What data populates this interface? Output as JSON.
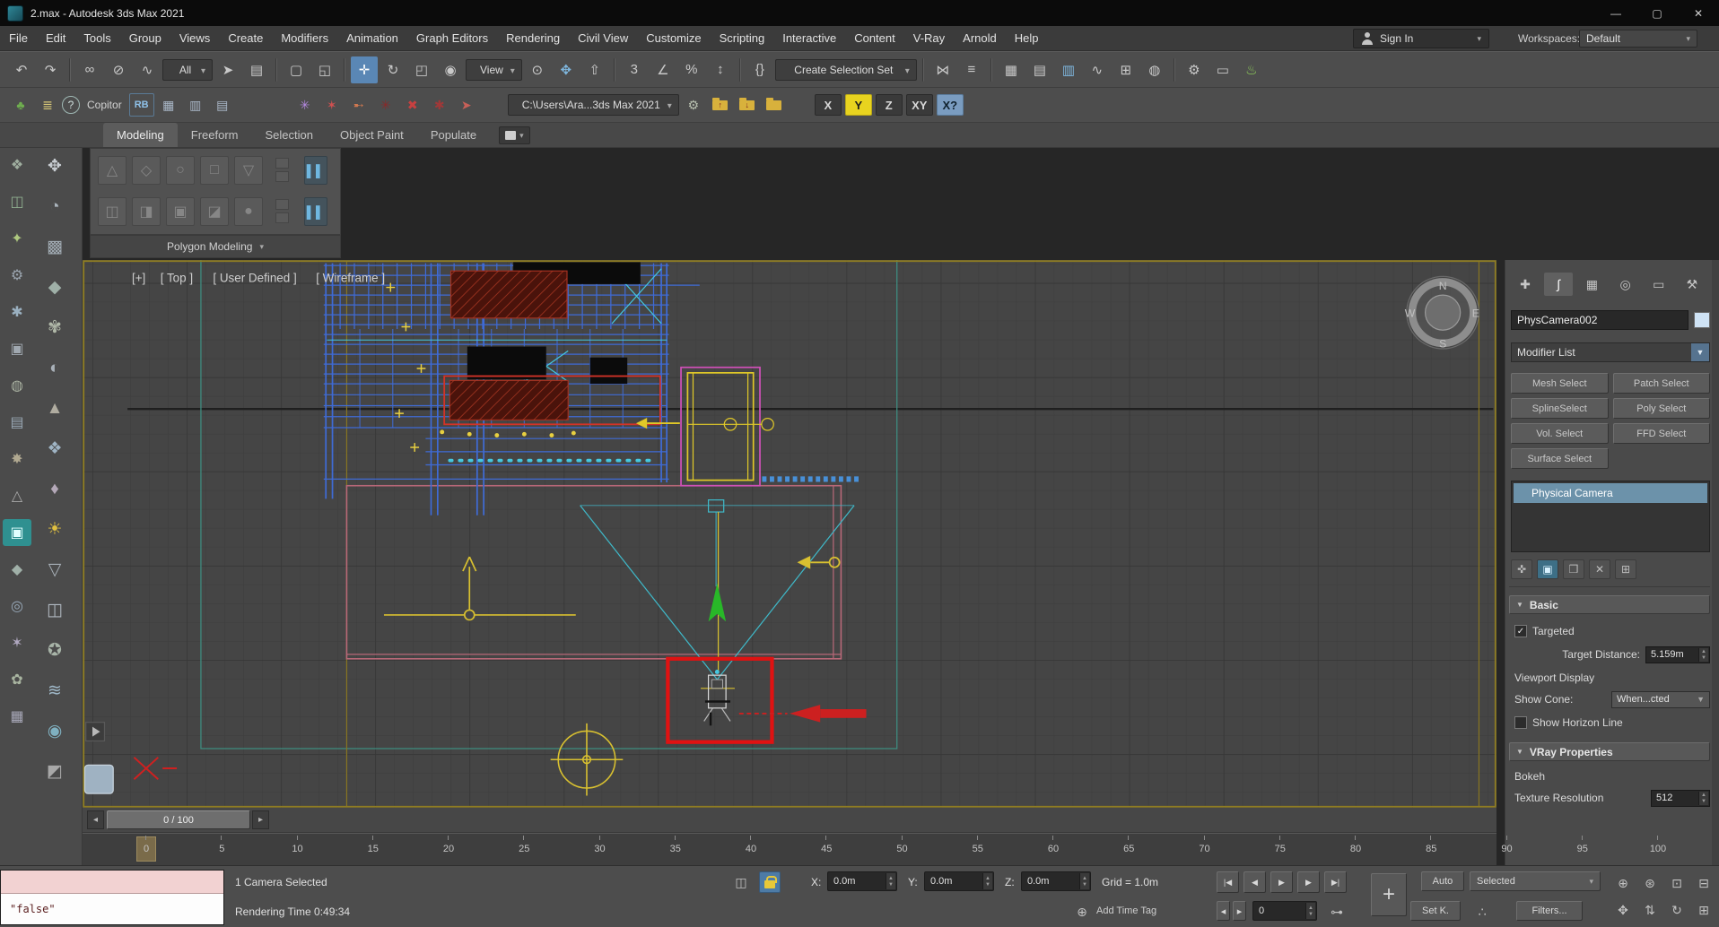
{
  "window": {
    "title": "2.max - Autodesk 3ds Max 2021",
    "controls": {
      "minimize": "—",
      "maximize": "▢",
      "close": "✕"
    }
  },
  "menubar": {
    "items": [
      "File",
      "Edit",
      "Tools",
      "Group",
      "Views",
      "Create",
      "Modifiers",
      "Animation",
      "Graph Editors",
      "Rendering",
      "Civil View",
      "Customize",
      "Scripting",
      "Interactive",
      "Content",
      "V-Ray",
      "Arnold",
      "Help"
    ],
    "sign_in": "Sign In",
    "sign_in_caret": "▾",
    "workspaces_label": "Workspaces:",
    "workspaces_value": "Default",
    "workspaces_caret": "▾"
  },
  "toolbar1": {
    "items": [
      {
        "name": "undo-icon",
        "kind": "icon",
        "glyph": "↶"
      },
      {
        "name": "redo-icon",
        "kind": "icon",
        "glyph": "↷"
      },
      {
        "name": "toolbar-separator",
        "kind": "sep"
      },
      {
        "name": "select-and-link-icon",
        "kind": "icon",
        "glyph": "∞"
      },
      {
        "name": "unlink-selection-icon",
        "kind": "icon",
        "glyph": "⊘"
      },
      {
        "name": "bind-to-space-warp-icon",
        "kind": "icon",
        "glyph": "∿"
      },
      {
        "name": "selection-filter-dropdown",
        "kind": "dd",
        "label": "All"
      },
      {
        "name": "select-object-icon",
        "kind": "icon",
        "glyph": "➤"
      },
      {
        "name": "select-by-name-icon",
        "kind": "icon",
        "glyph": "▤"
      },
      {
        "name": "toolbar-separator",
        "kind": "sep"
      },
      {
        "name": "rectangular-selection-icon",
        "kind": "icon",
        "glyph": "▢"
      },
      {
        "name": "window-crossing-icon",
        "kind": "icon",
        "glyph": "◱"
      },
      {
        "name": "toolbar-separator",
        "kind": "sep"
      },
      {
        "name": "select-and-move-icon",
        "kind": "icon",
        "glyph": "✛",
        "variant": "active"
      },
      {
        "name": "select-and-rotate-icon",
        "kind": "icon",
        "glyph": "↻"
      },
      {
        "name": "select-and-scale-icon",
        "kind": "icon",
        "glyph": "◰"
      },
      {
        "name": "select-and-place-icon",
        "kind": "icon",
        "glyph": "◉"
      },
      {
        "name": "reference-coordinate-dropdown",
        "kind": "dd",
        "label": "View"
      },
      {
        "name": "use-pivot-center-icon",
        "kind": "icon",
        "glyph": "⊙"
      },
      {
        "name": "select-and-manipulate-icon",
        "kind": "icon",
        "glyph": "✥",
        "variant": "blue"
      },
      {
        "name": "keyboard-shortcut-override-icon",
        "kind": "icon",
        "glyph": "⇧"
      },
      {
        "name": "toolbar-separator",
        "kind": "sep"
      },
      {
        "name": "snaps-toggle-icon",
        "kind": "icon",
        "glyph": "3"
      },
      {
        "name": "angle-snap-icon",
        "kind": "icon",
        "glyph": "∠"
      },
      {
        "name": "percent-snap-icon",
        "kind": "icon",
        "glyph": "%"
      },
      {
        "name": "spinner-snap-icon",
        "kind": "icon",
        "glyph": "↕"
      },
      {
        "name": "toolbar-separator",
        "kind": "sep"
      },
      {
        "name": "edit-named-selection-sets-icon",
        "kind": "icon",
        "glyph": "{}"
      },
      {
        "name": "named-selection-set-dropdown",
        "kind": "dd",
        "label": "Create Selection Set",
        "style": "min-width:158px"
      },
      {
        "name": "toolbar-separator",
        "kind": "sep"
      },
      {
        "name": "mirror-icon",
        "kind": "icon",
        "glyph": "⋈"
      },
      {
        "name": "align-icon",
        "kind": "icon",
        "glyph": "≡"
      },
      {
        "name": "toolbar-separator",
        "kind": "sep"
      },
      {
        "name": "scene-explorer-icon",
        "kind": "icon",
        "glyph": "▦"
      },
      {
        "name": "layer-explorer-icon",
        "kind": "icon",
        "glyph": "▤"
      },
      {
        "name": "ribbon-toggle-icon",
        "kind": "icon",
        "glyph": "▥",
        "variant": "blue"
      },
      {
        "name": "curve-editor-icon",
        "kind": "icon",
        "glyph": "∿"
      },
      {
        "name": "schematic-view-icon",
        "kind": "icon",
        "glyph": "⊞"
      },
      {
        "name": "material-editor-icon",
        "kind": "icon",
        "glyph": "◍"
      },
      {
        "name": "toolbar-separator",
        "kind": "sep"
      },
      {
        "name": "render-setup-icon",
        "kind": "icon",
        "glyph": "⚙"
      },
      {
        "name": "rendered-frame-window-icon",
        "kind": "icon",
        "glyph": "▭"
      },
      {
        "name": "render-production-icon",
        "kind": "icon",
        "glyph": "♨",
        "variant": "green"
      }
    ]
  },
  "toolbar2": {
    "items": [
      {
        "name": "plant-icon",
        "kind": "icon",
        "glyph": "♣",
        "style": "color:#6fae4f"
      },
      {
        "name": "menu-list-icon",
        "kind": "icon",
        "glyph": "≣",
        "style": "color:#d8c878"
      },
      {
        "name": "help-icon",
        "kind": "icon",
        "glyph": "?",
        "style": "color:#cfe0de;border:1px solid #9fb8b4;border-radius:50%;min-width:20px;height:20px;font-size:12px"
      },
      {
        "name": "copitor-label",
        "kind": "label",
        "label": "Copitor"
      },
      {
        "name": "rb-button",
        "kind": "icon",
        "glyph": "RB",
        "style": "color:#8fc1e8;font-size:11px;font-weight:bold;border:1px solid #5a7a96;border-radius:2px"
      },
      {
        "name": "array-table-icon",
        "kind": "icon",
        "glyph": "▦",
        "style": "color:#aab8c8"
      },
      {
        "name": "grid-table-icon",
        "kind": "icon",
        "glyph": "▥",
        "style": "color:#aab8c8"
      },
      {
        "name": "columns-table-icon",
        "kind": "icon",
        "glyph": "▤",
        "style": "color:#aab8c8"
      },
      {
        "name": "toolbar-gap",
        "kind": "gap",
        "style": "min-width:60px"
      },
      {
        "name": "script-star-purple-icon",
        "kind": "icon",
        "glyph": "✳",
        "style": "color:#b488e0"
      },
      {
        "name": "script-star-red-icon",
        "kind": "icon",
        "glyph": "✶",
        "style": "color:#d05050"
      },
      {
        "name": "script-arrow-icon",
        "kind": "icon",
        "glyph": "➸",
        "style": "color:#d07850"
      },
      {
        "name": "script-star-darkred-icon",
        "kind": "icon",
        "glyph": "✳",
        "style": "color:#8a2828"
      },
      {
        "name": "script-cross-icon",
        "kind": "icon",
        "glyph": "✖",
        "style": "color:#c84040"
      },
      {
        "name": "script-star-maroon-icon",
        "kind": "icon",
        "glyph": "✱",
        "style": "color:#a03838"
      },
      {
        "name": "script-pointer-icon",
        "kind": "icon",
        "glyph": "➤",
        "style": "color:#c86058"
      },
      {
        "name": "toolbar-gap",
        "kind": "gap",
        "style": "min-width:28px"
      },
      {
        "name": "project-path-dropdown",
        "kind": "dd",
        "label": "C:\\Users\\Ara...3ds Max 2021",
        "style": "min-width:170px"
      },
      {
        "name": "settings-gear-icon",
        "kind": "icon",
        "glyph": "⚙",
        "style": "color:#b8c0b0"
      },
      {
        "name": "folder-up-icon",
        "kind": "folder",
        "glyph": "↑"
      },
      {
        "name": "folder-down-icon",
        "kind": "folder",
        "glyph": "↓"
      },
      {
        "name": "folder-open-icon",
        "kind": "folder",
        "glyph": ""
      },
      {
        "name": "toolbar-gap",
        "kind": "gap",
        "style": "min-width:26px"
      },
      {
        "name": "axis-x-button",
        "kind": "axis",
        "label": "X"
      },
      {
        "name": "axis-y-button",
        "kind": "axis",
        "label": "Y",
        "variant": "yellow"
      },
      {
        "name": "axis-z-button",
        "kind": "axis",
        "label": "Z"
      },
      {
        "name": "axis-xy-button",
        "kind": "axis",
        "label": "XY"
      },
      {
        "name": "axis-x2-button",
        "kind": "axis",
        "label": "X?",
        "variant": "bluebg"
      }
    ]
  },
  "ribbon": {
    "tabs": [
      {
        "label": "Modeling",
        "variant": "active"
      },
      {
        "label": "Freeform"
      },
      {
        "label": "Selection"
      },
      {
        "label": "Object Paint"
      },
      {
        "label": "Populate"
      }
    ],
    "tab_menu_caret": "▾",
    "row1": [
      {
        "name": "polygon-tool-icon",
        "glyph": "△"
      },
      {
        "name": "loop-tool-icon",
        "glyph": "◇"
      },
      {
        "name": "ring-tool-icon",
        "glyph": "○"
      },
      {
        "name": "quad-tool-icon",
        "glyph": "□"
      },
      {
        "name": "cap-tool-icon",
        "glyph": "▽"
      }
    ],
    "row2": [
      {
        "name": "extrude-tool-icon",
        "glyph": "◫"
      },
      {
        "name": "bevel-tool-icon",
        "glyph": "◨"
      },
      {
        "name": "inset-tool-icon",
        "glyph": "▣"
      },
      {
        "name": "bridge-tool-icon",
        "glyph": "◪"
      },
      {
        "name": "weld-tool-icon",
        "glyph": "●"
      }
    ],
    "panel_toggle_glyph": "▌▌",
    "section_label": "Polygon Modeling",
    "section_caret": "▾"
  },
  "left_rail": {
    "col_a": [
      {
        "name": "scene-nodes-icon",
        "glyph": "❖",
        "style": "color:#9fae9f"
      },
      {
        "name": "group-objects-icon",
        "glyph": "◫",
        "style": "color:#8fae8f"
      },
      {
        "name": "light-tool-icon",
        "glyph": "✦",
        "style": "color:#aec87f"
      },
      {
        "name": "gear-tool-icon",
        "glyph": "⚙",
        "style": "color:#9aa4ae"
      },
      {
        "name": "snowflake-tool-icon",
        "glyph": "✱",
        "style": "color:#9ab0c0"
      },
      {
        "name": "box-primitive-icon",
        "glyph": "▣",
        "style": "color:#a0a8b0"
      },
      {
        "name": "sphere-primitive-icon",
        "glyph": "◍",
        "style": "color:#a8b0a0"
      },
      {
        "name": "plane-primitive-icon",
        "glyph": "▤",
        "style": "color:#9aa8b4"
      },
      {
        "name": "spray-tool-icon",
        "glyph": "✸",
        "style": "color:#b0a890"
      },
      {
        "name": "cone-primitive-icon",
        "glyph": "△",
        "style": "color:#a8a8a8"
      },
      {
        "name": "active-teal-tool-icon",
        "glyph": "▣",
        "variant": "accent"
      },
      {
        "name": "pentagon-tool-icon",
        "glyph": "◆",
        "style": "color:#a0b0a8"
      },
      {
        "name": "ring-tool-icon",
        "glyph": "◎",
        "style": "color:#99aabb"
      },
      {
        "name": "star-tool-icon",
        "glyph": "✶",
        "style": "color:#b0a8c0"
      },
      {
        "name": "flower-tool-icon",
        "glyph": "✿",
        "style": "color:#a8b4a0"
      },
      {
        "name": "mesh-grid-icon",
        "glyph": "▦",
        "style": "color:#a8a8b8"
      }
    ],
    "col_b": [
      {
        "name": "hand-tool-icon",
        "glyph": "✥",
        "style": "color:#c8cdd2"
      },
      {
        "name": "quarter-circle-icon",
        "glyph": "◔",
        "style": "color:#aab4bc"
      },
      {
        "name": "pattern-tool-icon",
        "glyph": "▩",
        "style": "color:#a2acb4"
      },
      {
        "name": "diamond-tool-icon",
        "glyph": "◆",
        "style": "color:#9fb0a8"
      },
      {
        "name": "blossom-tool-icon",
        "glyph": "✾",
        "style": "color:#b0b8a8"
      },
      {
        "name": "half-sphere-icon",
        "glyph": "◐",
        "style": "color:#a8b0b8"
      },
      {
        "name": "pyramid-tool-icon",
        "glyph": "▲",
        "style": "color:#b0aca0"
      },
      {
        "name": "node-web-icon",
        "glyph": "❖",
        "style": "color:#9fb4c4"
      },
      {
        "name": "gem-tool-icon",
        "glyph": "♦",
        "style": "color:#b4a8b8"
      },
      {
        "name": "sun-light-icon",
        "glyph": "☀",
        "style": "color:#e0c040"
      },
      {
        "name": "funnel-tool-icon",
        "glyph": "▽",
        "style": "color:#a8b0b8"
      },
      {
        "name": "window-tool-icon",
        "glyph": "◫",
        "style": "color:#b0b8c0"
      },
      {
        "name": "badge-tool-icon",
        "glyph": "✪",
        "style": "color:#a8b4a8"
      },
      {
        "name": "waves-tool-icon",
        "glyph": "≋",
        "style": "color:#9fb8c8"
      },
      {
        "name": "target-tool-icon",
        "glyph": "◉",
        "style": "color:#7fb0c0"
      },
      {
        "name": "corner-shade-icon",
        "glyph": "◩",
        "style": "color:#a8a8a8"
      }
    ]
  },
  "viewport": {
    "labels": {
      "plus": "[+]",
      "view": "[ Top ]",
      "pov": "[ User Defined ]",
      "shading": "[ Wireframe ]"
    },
    "compass": {
      "n": "N",
      "s": "S",
      "e": "E",
      "w": "W"
    }
  },
  "command_panel": {
    "tabs": [
      {
        "name": "create-tab-icon",
        "glyph": "✚"
      },
      {
        "name": "modify-tab-icon",
        "glyph": "∫",
        "variant": "active"
      },
      {
        "name": "hierarchy-tab-icon",
        "glyph": "▦"
      },
      {
        "name": "motion-tab-icon",
        "glyph": "◎"
      },
      {
        "name": "display-tab-icon",
        "glyph": "▭"
      },
      {
        "name": "utilities-tab-icon",
        "glyph": "⚒"
      }
    ],
    "object_name": "PhysCamera002",
    "modifier_list_label": "Modifier List",
    "dd_caret": "▼",
    "select_buttons": [
      "Mesh Select",
      "Patch Select",
      "SplineSelect",
      "Poly Select",
      "Vol. Select",
      "FFD Select",
      "Surface Select"
    ],
    "stack_selected": "Physical Camera",
    "stack_tools": [
      {
        "name": "pin-stack-icon",
        "glyph": "✜"
      },
      {
        "name": "show-end-result-icon",
        "glyph": "▣",
        "variant": "accent"
      },
      {
        "name": "make-unique-icon",
        "glyph": "❒"
      },
      {
        "name": "remove-modifier-icon",
        "glyph": "✕"
      },
      {
        "name": "configure-modifier-sets-icon",
        "glyph": "⊞"
      }
    ],
    "basic": {
      "title": "Basic",
      "collapse_glyph": "▼",
      "targeted_label": "Targeted",
      "check_glyph": "✓",
      "target_distance_label": "Target Distance:",
      "target_distance_value": "5.159m",
      "viewport_display_label": "Viewport Display",
      "show_cone_label": "Show Cone:",
      "show_cone_value": "When...cted",
      "show_horizon_label": "Show Horizon Line"
    },
    "vray": {
      "title": "VRay Properties",
      "collapse_glyph": "▼",
      "bokeh_label": "Bokeh",
      "texture_resolution_label": "Texture Resolution",
      "texture_resolution_value": "512"
    }
  },
  "timeline": {
    "prev_glyph": "◂",
    "next_glyph": "▸",
    "slider_label": "0 / 100",
    "ticks": [
      "0",
      "5",
      "10",
      "15",
      "20",
      "25",
      "30",
      "35",
      "40",
      "45",
      "50",
      "55",
      "60",
      "65",
      "70",
      "75",
      "80",
      "85",
      "90",
      "95",
      "100"
    ]
  },
  "statusbar": {
    "selection_status": "1 Camera Selected",
    "render_time": "Rendering Time  0:49:34",
    "isolate_glyph": "◫",
    "x_label": "X:",
    "y_label": "Y:",
    "z_label": "Z:",
    "x_value": "0.0m",
    "y_value": "0.0m",
    "z_value": "0.0m",
    "grid_label": "Grid = 1.0m",
    "time_tag_glyph": "⊕",
    "add_time_tag": "Add Time Tag",
    "playback": [
      {
        "name": "go-to-start-button",
        "glyph": "|◀"
      },
      {
        "name": "previous-frame-button",
        "glyph": "◀"
      },
      {
        "name": "play-button",
        "glyph": "▶"
      },
      {
        "name": "next-frame-button",
        "glyph": "▶"
      },
      {
        "name": "go-to-end-button",
        "glyph": "▶|"
      }
    ],
    "set_keys_label": "+",
    "auto_key_label": "Auto",
    "selected_filter": "Selected",
    "selected_caret": "▾",
    "frame_prev_glyph": "◂",
    "frame_next_glyph": "▸",
    "frame_value": "0",
    "key_icon_glyph": "⊶",
    "set_key_label": "Set K.",
    "key_filter_glyph": "∴",
    "filters_label": "Filters...",
    "nav": [
      {
        "name": "zoom-icon",
        "glyph": "⊕"
      },
      {
        "name": "zoom-all-icon",
        "glyph": "⊛"
      },
      {
        "name": "zoom-extents-icon",
        "glyph": "⊡"
      },
      {
        "name": "zoom-region-icon",
        "glyph": "⊟"
      },
      {
        "name": "pan-icon",
        "glyph": "✥"
      },
      {
        "name": "walk-through-icon",
        "glyph": "⇅"
      },
      {
        "name": "orbit-icon",
        "glyph": "↻"
      },
      {
        "name": "maximize-viewport-icon",
        "glyph": "⊞"
      }
    ]
  },
  "listener": {
    "value": "\"false\""
  }
}
